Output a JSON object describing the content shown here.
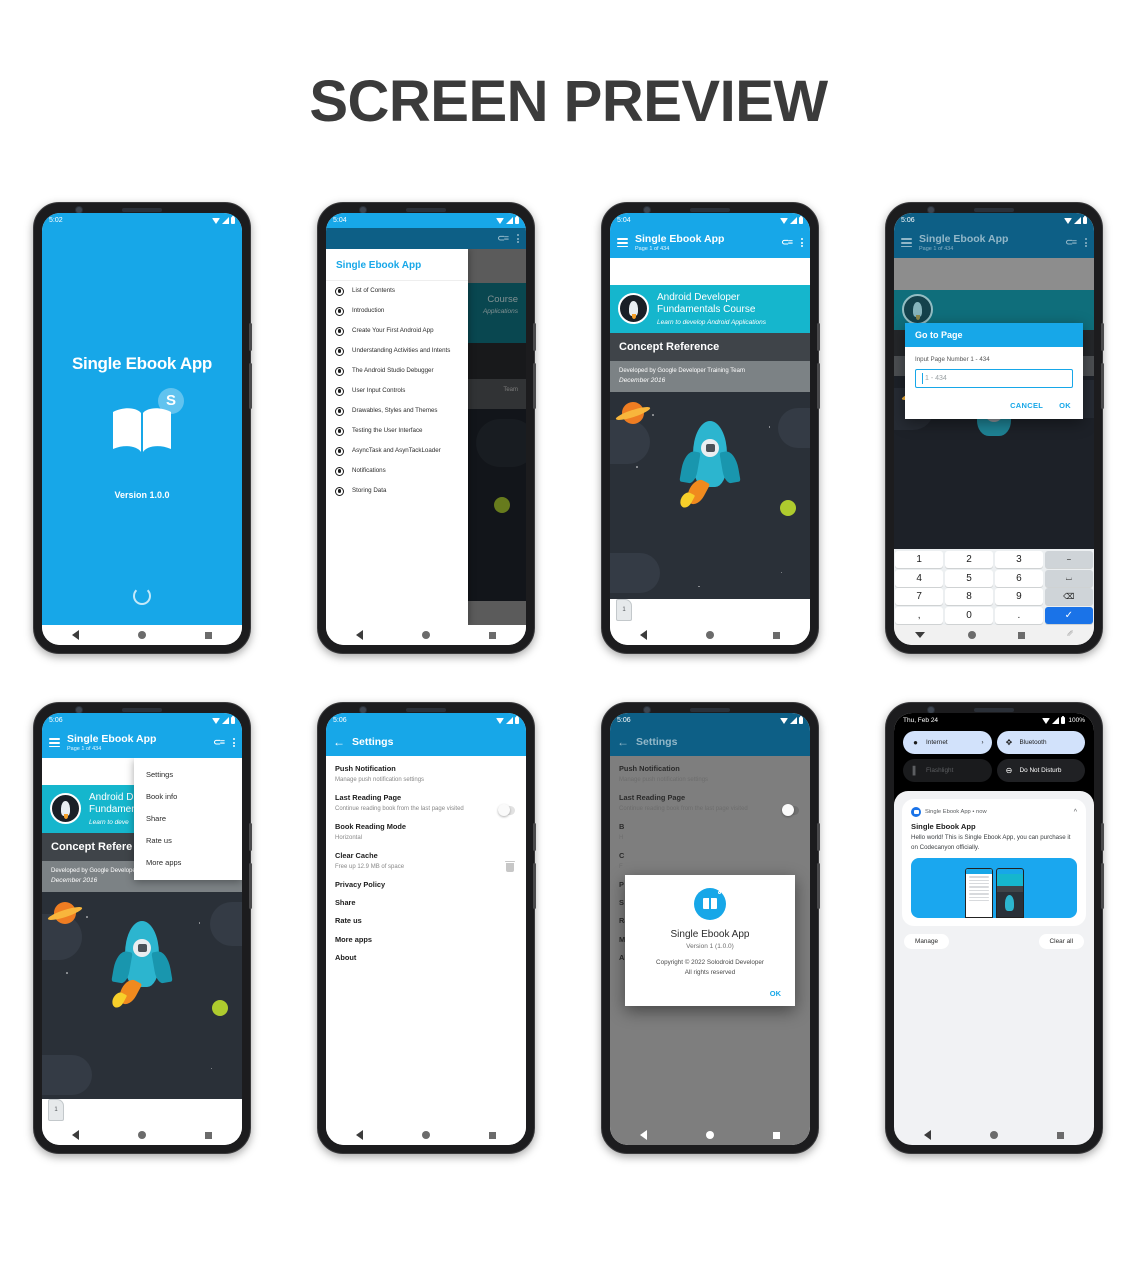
{
  "page": {
    "title": "SCREEN PREVIEW"
  },
  "app": {
    "name": "Single Ebook App",
    "version_label": "Version 1.0.0",
    "logo_badge": "S",
    "accent": "#17a7e8"
  },
  "screen1": {
    "status_time": "5:02",
    "title": "Single Ebook App",
    "version": "Version 1.0.0",
    "badge": "S"
  },
  "screen2": {
    "status_time": "5:04",
    "drawer_title": "Single Ebook App",
    "items": [
      "List of Contents",
      "Introduction",
      "Create Your First Android App",
      "Understanding Activities and Intents",
      "The Android Studio Debugger",
      "User Input Controls",
      "Drawables, Styles and Themes",
      "Testing the User Interface",
      "AsyncTask and AsynTackLoader",
      "Notifications",
      "Storing Data"
    ],
    "bg_hero_title": "Course",
    "bg_hero_sub": "Applications",
    "bg_band": "Team"
  },
  "screen3": {
    "status_time": "5:04",
    "appbar_title": "Single Ebook App",
    "appbar_subtitle": "Page 1 of 434",
    "hero_title_line1": "Android Developer",
    "hero_title_line2": "Fundamentals Course",
    "hero_subtitle": "Learn to develop Android Applications",
    "band_title": "Concept Reference",
    "credit_line1": "Developed by Google Developer Training Team",
    "credit_line2": "December 2016",
    "page_tab": "1"
  },
  "screen4": {
    "status_time": "5:06",
    "appbar_title": "Single Ebook App",
    "appbar_subtitle": "Page 1 of 434",
    "dialog_title": "Go to Page",
    "dialog_label": "Input Page Number 1 - 434",
    "input_placeholder": "1 - 434",
    "input_value": "",
    "cancel_label": "CANCEL",
    "ok_label": "OK",
    "keypad": [
      [
        "1",
        "2",
        "3",
        "−"
      ],
      [
        "4",
        "5",
        "6",
        "⌴"
      ],
      [
        "7",
        "8",
        "9",
        "⌫"
      ],
      [
        ",",
        "0",
        ".",
        "✓"
      ]
    ]
  },
  "screen5": {
    "status_time": "5:06",
    "appbar_title": "Single Ebook App",
    "appbar_subtitle": "Page 1 of 434",
    "menu_items": [
      "Settings",
      "Book info",
      "Share",
      "Rate us",
      "More apps"
    ],
    "hero_title_line1": "Android D",
    "hero_title_line2": "Fundamen",
    "hero_subtitle": "Learn to deve",
    "band_title": "Concept Refere",
    "credit_line1": "Developed by Google Developer Training Team",
    "credit_line2": "December 2016",
    "page_tab": "1"
  },
  "screen6": {
    "status_time": "5:06",
    "appbar_title": "Settings",
    "items": [
      {
        "title": "Push Notification",
        "desc": "Manage push notification settings"
      },
      {
        "title": "Last Reading Page",
        "desc": "Continue reading book from the last page visited"
      },
      {
        "title": "Book Reading Mode",
        "desc": "Horizontal"
      },
      {
        "title": "Clear Cache",
        "desc": "Free up 12.9 MB of space"
      },
      {
        "title": "Privacy Policy",
        "desc": ""
      },
      {
        "title": "Share",
        "desc": ""
      },
      {
        "title": "Rate us",
        "desc": ""
      },
      {
        "title": "More apps",
        "desc": ""
      },
      {
        "title": "About",
        "desc": ""
      }
    ]
  },
  "screen7": {
    "status_time": "5:06",
    "appbar_title": "Settings",
    "items": [
      {
        "title": "Push Notification",
        "desc": "Manage push notification settings"
      },
      {
        "title": "Last Reading Page",
        "desc": "Continue reading book from the last page visited"
      },
      {
        "title": "B",
        "desc": "H"
      },
      {
        "title": "C",
        "desc": "F"
      },
      {
        "title": "P",
        "desc": ""
      },
      {
        "title": "S",
        "desc": ""
      },
      {
        "title": "Rate us",
        "desc": ""
      },
      {
        "title": "More apps",
        "desc": ""
      },
      {
        "title": "About",
        "desc": ""
      }
    ],
    "dialog": {
      "app_name": "Single Ebook App",
      "version": "Version 1 (1.0.0)",
      "copyright_line1": "Copyright © 2022 Solodroid Developer",
      "copyright_line2": "All rights reserved",
      "ok_label": "OK"
    }
  },
  "screen8": {
    "status_date": "Thu, Feb 24",
    "battery": "100%",
    "quick_settings": [
      {
        "label": "Internet",
        "icon": "wifi-icon",
        "state": "on",
        "chevron": "›"
      },
      {
        "label": "Bluetooth",
        "icon": "bluetooth-icon",
        "state": "on",
        "chevron": ""
      },
      {
        "label": "Flashlight",
        "icon": "flashlight-icon",
        "state": "disabled",
        "chevron": ""
      },
      {
        "label": "Do Not Disturb",
        "icon": "dnd-icon",
        "state": "off",
        "chevron": ""
      }
    ],
    "notification": {
      "app_line": "Single Ebook App • now",
      "title": "Single Ebook App",
      "body": "Hello world! This is Single Ebook App, you can purchase it on Codecanyon officially."
    },
    "manage_label": "Manage",
    "clear_all_label": "Clear all"
  }
}
